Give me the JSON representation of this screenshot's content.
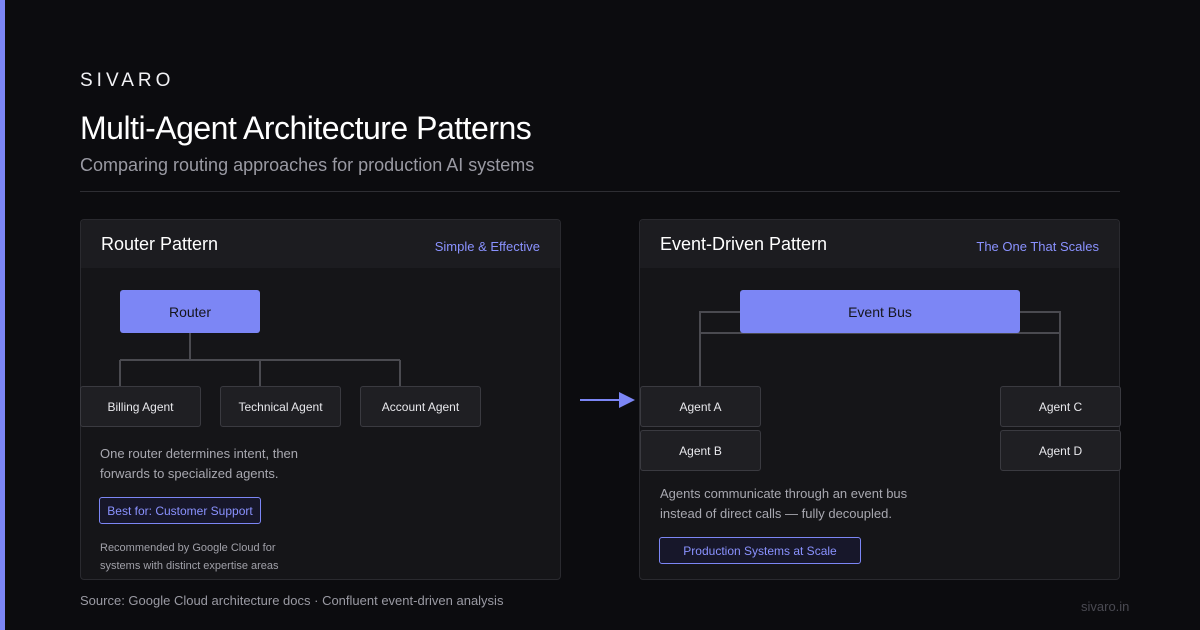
{
  "header": {
    "brand": "SIVARO",
    "title": "Multi-Agent Architecture Patterns",
    "subtitle": "Comparing routing approaches for production AI systems"
  },
  "router_panel": {
    "title": "Router Pattern",
    "tag": "Simple & Effective",
    "router_label": "Router",
    "agents": [
      "Billing Agent",
      "Technical Agent",
      "Account Agent"
    ],
    "description_line1": "One router determines intent, then",
    "description_line2": "forwards to specialized agents.",
    "badge": "Best for: Customer Support",
    "note_line1": "Recommended by Google Cloud for",
    "note_line2": "systems with distinct expertise areas"
  },
  "event_panel": {
    "title": "Event-Driven Pattern",
    "tag": "The One That Scales",
    "bus_label": "Event Bus",
    "agents": [
      "Agent A",
      "Agent B",
      "Agent C",
      "Agent D"
    ],
    "description_line1": "Agents communicate through an event bus",
    "description_line2": "instead of direct calls — fully decoupled.",
    "badge": "Production Systems at Scale"
  },
  "footer": {
    "source": "Source: Google Cloud architecture docs · Confluent event-driven analysis",
    "site": "sivaro.in"
  },
  "colors": {
    "accent": "#7c86f5",
    "background": "#0c0c0f",
    "panel": "#151518",
    "node": "#1f1f23",
    "connector": "#4a4a50"
  },
  "icons": [
    "arrow-right-icon"
  ]
}
